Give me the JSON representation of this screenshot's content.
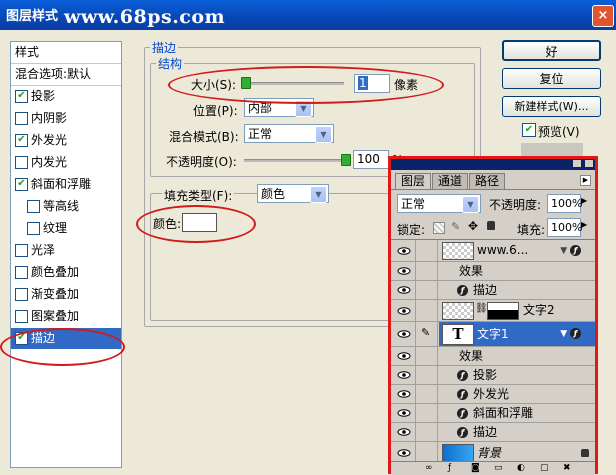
{
  "window": {
    "title": "图层样式",
    "watermark": "www.68ps.com",
    "close_label": "×"
  },
  "style_list": {
    "header": "样式",
    "items": [
      {
        "label": "混合选项:默认",
        "checkbox": false,
        "checked": false
      },
      {
        "label": "投影",
        "checkbox": true,
        "checked": true
      },
      {
        "label": "内阴影",
        "checkbox": true,
        "checked": false
      },
      {
        "label": "外发光",
        "checkbox": true,
        "checked": true
      },
      {
        "label": "内发光",
        "checkbox": true,
        "checked": false
      },
      {
        "label": "斜面和浮雕",
        "checkbox": true,
        "checked": true
      },
      {
        "label": "等高线",
        "checkbox": true,
        "checked": false
      },
      {
        "label": "纹理",
        "checkbox": true,
        "checked": false
      },
      {
        "label": "光泽",
        "checkbox": true,
        "checked": false
      },
      {
        "label": "颜色叠加",
        "checkbox": true,
        "checked": false
      },
      {
        "label": "渐变叠加",
        "checkbox": true,
        "checked": false
      },
      {
        "label": "图案叠加",
        "checkbox": true,
        "checked": false
      },
      {
        "label": "描边",
        "checkbox": true,
        "checked": true
      }
    ],
    "checkmark": "✔"
  },
  "stroke": {
    "group_title": "描边",
    "structure_title": "结构",
    "size_label": "大小(S):",
    "size_value": "1",
    "size_unit": "像素",
    "position_label": "位置(P):",
    "position_value": "内部",
    "blend_label": "混合模式(B):",
    "blend_value": "正常",
    "opacity_label": "不透明度(O):",
    "opacity_value": "100",
    "opacity_unit": "%",
    "fill_type_label": "填充类型(F):",
    "fill_type_value": "颜色",
    "color_label": "颜色:",
    "color_swatch": "#ffffff"
  },
  "buttons": {
    "ok": "好",
    "reset": "复位",
    "new_style": "新建样式(W)...",
    "preview": "预览(V)"
  },
  "layers_panel": {
    "tabs": [
      "图层",
      "通道",
      "路径"
    ],
    "blend_mode": "正常",
    "opacity_label": "不透明度:",
    "opacity_value": "100%",
    "lock_label": "锁定:",
    "fill_label": "填充:",
    "fill_value": "100%",
    "rows": [
      {
        "type": "layer",
        "name": "www.6...",
        "fx": true
      },
      {
        "type": "effects",
        "name": "效果"
      },
      {
        "type": "effect",
        "name": "描边"
      },
      {
        "type": "layer",
        "name": "文字2",
        "fx": false
      },
      {
        "type": "layer-selected",
        "name": "文字1",
        "fx": true,
        "thumb": "T"
      },
      {
        "type": "effects",
        "name": "效果"
      },
      {
        "type": "effect",
        "name": "投影"
      },
      {
        "type": "effect",
        "name": "外发光"
      },
      {
        "type": "effect",
        "name": "斜面和浮雕"
      },
      {
        "type": "effect",
        "name": "描边"
      },
      {
        "type": "background",
        "name": "背景"
      }
    ]
  },
  "colors": {
    "title_bar": "#0846b4",
    "selection": "#316ac5",
    "annotation": "#d11a1a"
  }
}
